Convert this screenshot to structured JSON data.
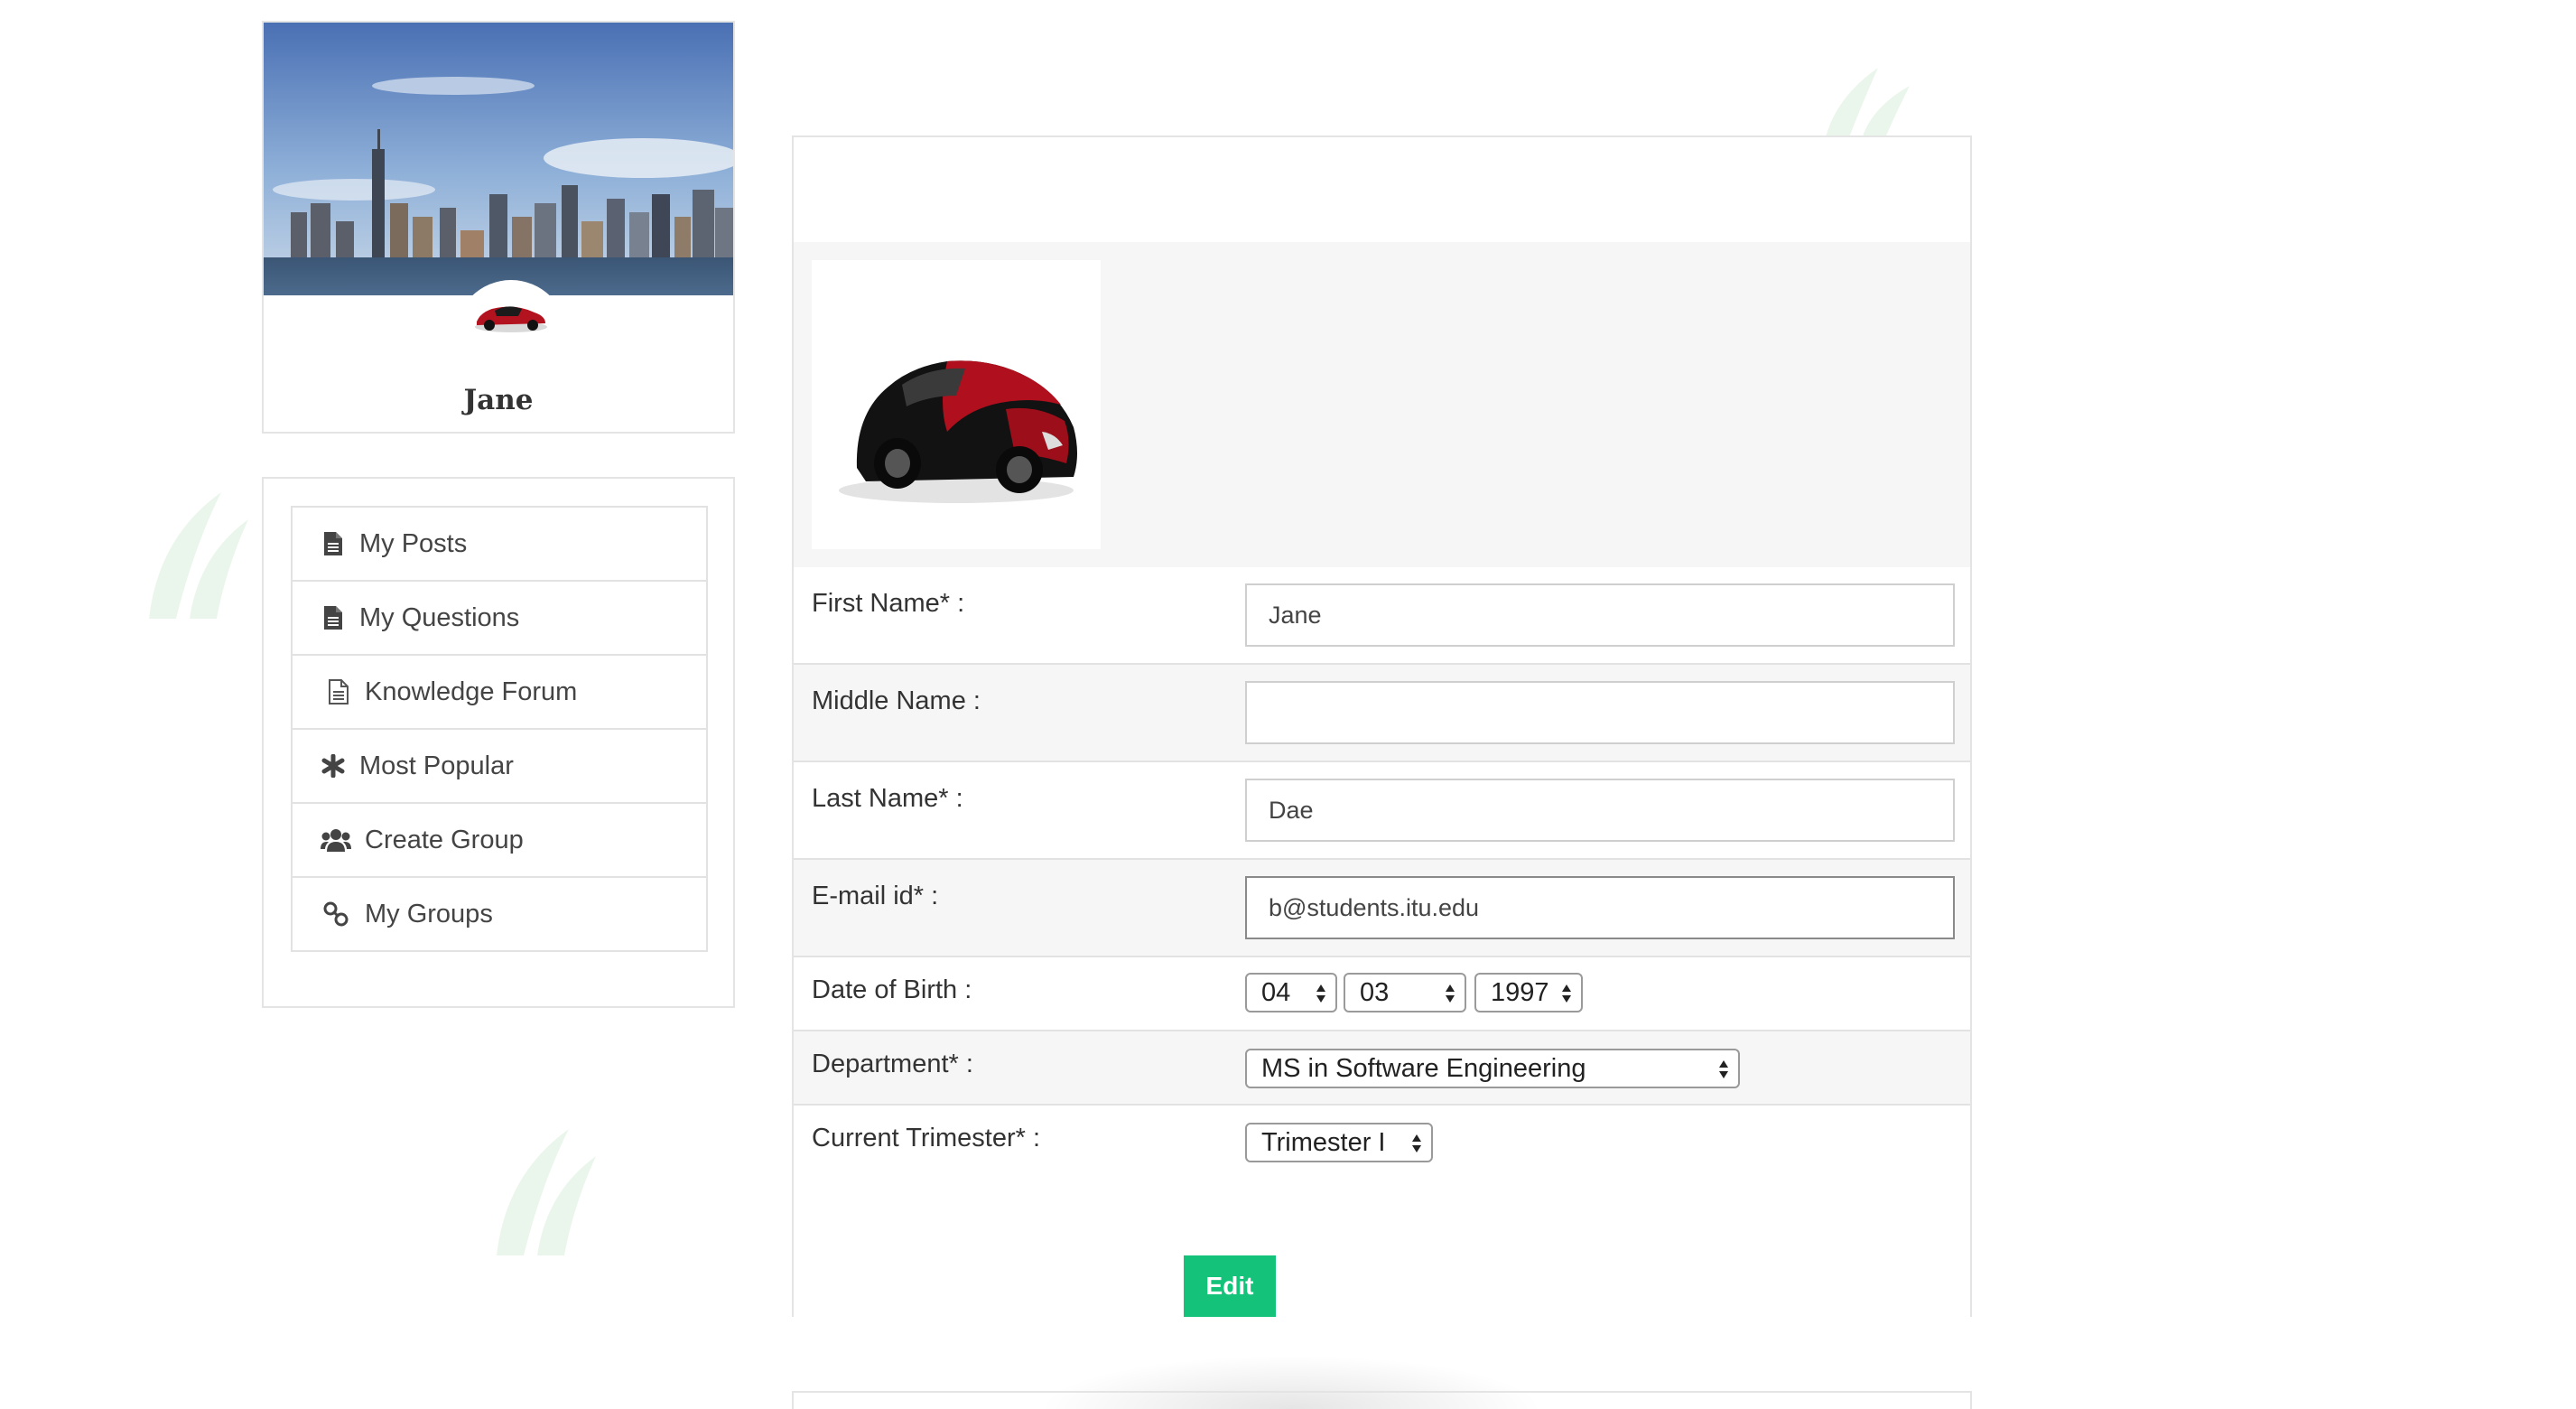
{
  "profile": {
    "name": "Jane",
    "cover_icon": "city-skyline-image",
    "avatar_icon": "red-sports-car-image"
  },
  "nav": {
    "items": [
      {
        "label": "My Posts",
        "icon": "document-icon"
      },
      {
        "label": "My Questions",
        "icon": "document-icon"
      },
      {
        "label": "Knowledge Forum",
        "icon": "document-outline-icon"
      },
      {
        "label": "Most Popular",
        "icon": "asterisk-icon"
      },
      {
        "label": "Create Group",
        "icon": "users-icon"
      },
      {
        "label": "My Groups",
        "icon": "link-icon"
      }
    ]
  },
  "form": {
    "photo_icon": "red-sports-car-image",
    "first_name": {
      "label": "First Name* :",
      "value": "Jane"
    },
    "middle_name": {
      "label": "Middle Name :",
      "value": ""
    },
    "last_name": {
      "label": "Last Name* :",
      "value": "Dae"
    },
    "email": {
      "label": "E-mail id* :",
      "value": "b@students.itu.edu"
    },
    "dob": {
      "label": "Date of Birth :",
      "day": "04",
      "month": "03",
      "year": "1997"
    },
    "department": {
      "label": "Department* :",
      "value": "MS in Software Engineering"
    },
    "trimester": {
      "label": "Current Trimester* :",
      "value": "Trimester I"
    },
    "edit_label": "Edit"
  },
  "colors": {
    "accent_green": "#14c27a",
    "border": "#e2e2e2",
    "row_alt_bg": "#f6f6f6",
    "leaf_green": "#e6f7ea"
  }
}
